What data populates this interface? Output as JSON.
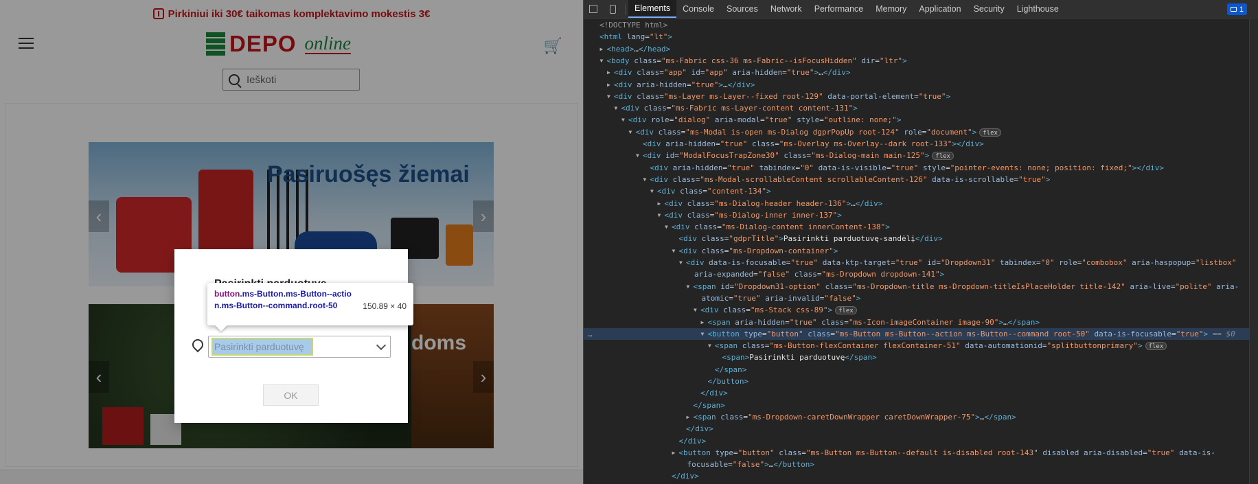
{
  "page": {
    "promo_text": "Pirkiniui iki 30€ taikomas komplektavimo mokestis 3€",
    "logo_text": "DEPO",
    "logo_online": "online",
    "search_placeholder": "Ieškoti",
    "banner1_title": "Pasiruošęs žiemai",
    "banner2_text": "doms",
    "dialog": {
      "title": "Pasirinkti parduotuvę",
      "dropdown_value": "Pasirinkti parduotuvę",
      "ok_label": "OK"
    },
    "tooltip": {
      "tag": "button",
      "selector": ".ms-Button.ms-Button--action.ms-Button--command.root-50",
      "dims": "150.89 × 40"
    }
  },
  "devtools": {
    "tabs": [
      "Elements",
      "Console",
      "Sources",
      "Network",
      "Performance",
      "Memory",
      "Application",
      "Security",
      "Lighthouse"
    ],
    "active_tab": "Elements",
    "issues_count": "1",
    "dom_lines": [
      {
        "indent": 0,
        "arrow": "",
        "html": "<span class='tok-kw'>&lt;!DOCTYPE html&gt;</span>"
      },
      {
        "indent": 0,
        "arrow": "",
        "html": "<span class='tok-tag'>&lt;html</span> <span class='tok-attr'>lang</span>=<span class='tok-val'>\"lt\"</span><span class='tok-tag'>&gt;</span>"
      },
      {
        "indent": 1,
        "arrow": "▶",
        "html": "<span class='tok-tag'>&lt;head&gt;</span>…<span class='tok-tag'>&lt;/head&gt;</span>"
      },
      {
        "indent": 1,
        "arrow": "▼",
        "html": "<span class='tok-tag'>&lt;body</span> <span class='tok-attr'>class</span>=<span class='tok-val'>\"ms-Fabric css-36 ms-Fabric--isFocusHidden\"</span> <span class='tok-attr'>dir</span>=<span class='tok-val'>\"ltr\"</span><span class='tok-tag'>&gt;</span>"
      },
      {
        "indent": 2,
        "arrow": "▶",
        "html": "<span class='tok-tag'>&lt;div</span> <span class='tok-attr'>class</span>=<span class='tok-val'>\"app\"</span> <span class='tok-attr'>id</span>=<span class='tok-val'>\"app\"</span> <span class='tok-attr'>aria-hidden</span>=<span class='tok-val'>\"true\"</span><span class='tok-tag'>&gt;</span>…<span class='tok-tag'>&lt;/div&gt;</span>"
      },
      {
        "indent": 2,
        "arrow": "▶",
        "html": "<span class='tok-tag'>&lt;div</span> <span class='tok-attr'>aria-hidden</span>=<span class='tok-val'>\"true\"</span><span class='tok-tag'>&gt;</span>…<span class='tok-tag'>&lt;/div&gt;</span>"
      },
      {
        "indent": 2,
        "arrow": "▼",
        "html": "<span class='tok-tag'>&lt;div</span> <span class='tok-attr'>class</span>=<span class='tok-val'>\"ms-Layer ms-Layer--fixed root-129\"</span> <span class='tok-attr'>data-portal-element</span>=<span class='tok-val'>\"true\"</span><span class='tok-tag'>&gt;</span>"
      },
      {
        "indent": 3,
        "arrow": "▼",
        "html": "<span class='tok-tag'>&lt;div</span> <span class='tok-attr'>class</span>=<span class='tok-val'>\"ms-Fabric ms-Layer-content content-131\"</span><span class='tok-tag'>&gt;</span>"
      },
      {
        "indent": 4,
        "arrow": "▼",
        "html": "<span class='tok-tag'>&lt;div</span> <span class='tok-attr'>role</span>=<span class='tok-val'>\"dialog\"</span> <span class='tok-attr'>aria-modal</span>=<span class='tok-val'>\"true\"</span> <span class='tok-attr'>style</span>=<span class='tok-val'>\"outline: none;\"</span><span class='tok-tag'>&gt;</span>"
      },
      {
        "indent": 5,
        "arrow": "▼",
        "html": "<span class='tok-tag'>&lt;div</span> <span class='tok-attr'>class</span>=<span class='tok-val'>\"ms-Modal is-open ms-Dialog dgprPopUp root-124\"</span> <span class='tok-attr'>role</span>=<span class='tok-val'>\"document\"</span><span class='tok-tag'>&gt;</span><span class='pill'>flex</span>"
      },
      {
        "indent": 6,
        "arrow": "",
        "html": "<span class='tok-tag'>&lt;div</span> <span class='tok-attr'>aria-hidden</span>=<span class='tok-val'>\"true\"</span> <span class='tok-attr'>class</span>=<span class='tok-val'>\"ms-Overlay ms-Overlay--dark root-133\"</span><span class='tok-tag'>&gt;&lt;/div&gt;</span>"
      },
      {
        "indent": 6,
        "arrow": "▼",
        "html": "<span class='tok-tag'>&lt;div</span> <span class='tok-attr'>id</span>=<span class='tok-val'>\"ModalFocusTrapZone30\"</span> <span class='tok-attr'>class</span>=<span class='tok-val'>\"ms-Dialog-main main-125\"</span><span class='tok-tag'>&gt;</span><span class='pill'>flex</span>"
      },
      {
        "indent": 7,
        "arrow": "",
        "html": "<span class='tok-tag'>&lt;div</span> <span class='tok-attr'>aria-hidden</span>=<span class='tok-val'>\"true\"</span> <span class='tok-attr'>tabindex</span>=<span class='tok-val'>\"0\"</span> <span class='tok-attr'>data-is-visible</span>=<span class='tok-val'>\"true\"</span> <span class='tok-attr'>style</span>=<span class='tok-val'>\"pointer-events: none; position: fixed;\"</span><span class='tok-tag'>&gt;&lt;/div&gt;</span>"
      },
      {
        "indent": 7,
        "arrow": "▼",
        "html": "<span class='tok-tag'>&lt;div</span> <span class='tok-attr'>class</span>=<span class='tok-val'>\"ms-Modal-scrollableContent scrollableContent-126\"</span> <span class='tok-attr'>data-is-scrollable</span>=<span class='tok-val'>\"true\"</span><span class='tok-tag'>&gt;</span>"
      },
      {
        "indent": 8,
        "arrow": "▼",
        "html": "<span class='tok-tag'>&lt;div</span> <span class='tok-attr'>class</span>=<span class='tok-val'>\"content-134\"</span><span class='tok-tag'>&gt;</span>"
      },
      {
        "indent": 9,
        "arrow": "▶",
        "html": "<span class='tok-tag'>&lt;div</span> <span class='tok-attr'>class</span>=<span class='tok-val'>\"ms-Dialog-header header-136\"</span><span class='tok-tag'>&gt;</span>…<span class='tok-tag'>&lt;/div&gt;</span>"
      },
      {
        "indent": 9,
        "arrow": "▼",
        "html": "<span class='tok-tag'>&lt;div</span> <span class='tok-attr'>class</span>=<span class='tok-val'>\"ms-Dialog-inner inner-137\"</span><span class='tok-tag'>&gt;</span>"
      },
      {
        "indent": 10,
        "arrow": "▼",
        "html": "<span class='tok-tag'>&lt;div</span> <span class='tok-attr'>class</span>=<span class='tok-val'>\"ms-Dialog-content innerContent-138\"</span><span class='tok-tag'>&gt;</span>"
      },
      {
        "indent": 11,
        "arrow": "",
        "html": "<span class='tok-tag'>&lt;div</span> <span class='tok-attr'>class</span>=<span class='tok-val'>\"gdprTitle\"</span><span class='tok-tag'>&gt;</span><span class='tok-text'>Pasirinkti parduotuvę-sandėlį</span><span class='tok-tag'>&lt;/div&gt;</span>"
      },
      {
        "indent": 11,
        "arrow": "▼",
        "html": "<span class='tok-tag'>&lt;div</span> <span class='tok-attr'>class</span>=<span class='tok-val'>\"ms-Dropdown-container\"</span><span class='tok-tag'>&gt;</span>"
      },
      {
        "indent": 12,
        "arrow": "▼",
        "html": "<span class='tok-tag'>&lt;div</span> <span class='tok-attr'>data-is-focusable</span>=<span class='tok-val'>\"true\"</span> <span class='tok-attr'>data-ktp-target</span>=<span class='tok-val'>\"true\"</span> <span class='tok-attr'>id</span>=<span class='tok-val'>\"Dropdown31\"</span> <span class='tok-attr'>tabindex</span>=<span class='tok-val'>\"0\"</span> <span class='tok-attr'>role</span>=<span class='tok-val'>\"combobox\"</span> <span class='tok-attr'>aria-haspopup</span>=<span class='tok-val'>\"listbox\"</span>"
      },
      {
        "indent": 12,
        "arrow": "",
        "cont": true,
        "html": "<span class='tok-attr'>aria-expanded</span>=<span class='tok-val'>\"false\"</span> <span class='tok-attr'>class</span>=<span class='tok-val'>\"ms-Dropdown dropdown-141\"</span><span class='tok-tag'>&gt;</span>"
      },
      {
        "indent": 13,
        "arrow": "▼",
        "html": "<span class='tok-tag'>&lt;span</span> <span class='tok-attr'>id</span>=<span class='tok-val'>\"Dropdown31-option\"</span> <span class='tok-attr'>class</span>=<span class='tok-val'>\"ms-Dropdown-title ms-Dropdown-titleIsPlaceHolder title-142\"</span> <span class='tok-attr'>aria-live</span>=<span class='tok-val'>\"polite\"</span> <span class='tok-attr'>aria-</span>"
      },
      {
        "indent": 13,
        "arrow": "",
        "cont": true,
        "html": "<span class='tok-attr'>atomic</span>=<span class='tok-val'>\"true\"</span> <span class='tok-attr'>aria-invalid</span>=<span class='tok-val'>\"false\"</span><span class='tok-tag'>&gt;</span>"
      },
      {
        "indent": 14,
        "arrow": "▼",
        "html": "<span class='tok-tag'>&lt;div</span> <span class='tok-attr'>class</span>=<span class='tok-val'>\"ms-Stack css-89\"</span><span class='tok-tag'>&gt;</span><span class='pill'>flex</span>"
      },
      {
        "indent": 15,
        "arrow": "▶",
        "html": "<span class='tok-tag'>&lt;span</span> <span class='tok-attr'>aria-hidden</span>=<span class='tok-val'>\"true\"</span> <span class='tok-attr'>class</span>=<span class='tok-val'>\"ms-Icon-imageContainer image-90\"</span><span class='tok-tag'>&gt;</span>…<span class='tok-tag'>&lt;/span&gt;</span>"
      },
      {
        "indent": 15,
        "arrow": "▼",
        "sel": true,
        "html": "<span class='tok-tag'>&lt;button</span> <span class='tok-attr'>type</span>=<span class='tok-val'>\"button\"</span> <span class='tok-attr'>class</span>=<span class='tok-val'>\"ms-Button ms-Button--action ms-Button--command root-50\"</span> <span class='tok-attr'>data-is-focusable</span>=<span class='tok-val'>\"true\"</span><span class='tok-tag'>&gt;</span> <span class='eq'>== $0</span>"
      },
      {
        "indent": 16,
        "arrow": "▼",
        "html": "<span class='tok-tag'>&lt;span</span> <span class='tok-attr'>class</span>=<span class='tok-val'>\"ms-Button-flexContainer flexContainer-51\"</span> <span class='tok-attr'>data-automationid</span>=<span class='tok-val'>\"splitbuttonprimary\"</span><span class='tok-tag'>&gt;</span><span class='pill'>flex</span>"
      },
      {
        "indent": 17,
        "arrow": "",
        "html": "<span class='tok-tag'>&lt;span&gt;</span><span class='tok-text'>Pasirinkti parduotuvę</span><span class='tok-tag'>&lt;/span&gt;</span>"
      },
      {
        "indent": 16,
        "arrow": "",
        "html": "<span class='tok-tag'>&lt;/span&gt;</span>"
      },
      {
        "indent": 15,
        "arrow": "",
        "html": "<span class='tok-tag'>&lt;/button&gt;</span>"
      },
      {
        "indent": 14,
        "arrow": "",
        "html": "<span class='tok-tag'>&lt;/div&gt;</span>"
      },
      {
        "indent": 13,
        "arrow": "",
        "html": "<span class='tok-tag'>&lt;/span&gt;</span>"
      },
      {
        "indent": 13,
        "arrow": "▶",
        "html": "<span class='tok-tag'>&lt;span</span> <span class='tok-attr'>class</span>=<span class='tok-val'>\"ms-Dropdown-caretDownWrapper caretDownWrapper-75\"</span><span class='tok-tag'>&gt;</span>…<span class='tok-tag'>&lt;/span&gt;</span>"
      },
      {
        "indent": 12,
        "arrow": "",
        "html": "<span class='tok-tag'>&lt;/div&gt;</span>"
      },
      {
        "indent": 11,
        "arrow": "",
        "html": "<span class='tok-tag'>&lt;/div&gt;</span>"
      },
      {
        "indent": 11,
        "arrow": "▶",
        "html": "<span class='tok-tag'>&lt;button</span> <span class='tok-attr'>type</span>=<span class='tok-val'>\"button\"</span> <span class='tok-attr'>class</span>=<span class='tok-val'>\"ms-Button ms-Button--default is-disabled root-143\"</span> <span class='tok-attr'>disabled</span> <span class='tok-attr'>aria-disabled</span>=<span class='tok-val'>\"true\"</span> <span class='tok-attr'>data-is-</span>"
      },
      {
        "indent": 11,
        "arrow": "",
        "cont": true,
        "html": "<span class='tok-attr'>focusable</span>=<span class='tok-val'>\"false\"</span><span class='tok-tag'>&gt;</span>…<span class='tok-tag'>&lt;/button&gt;</span>"
      },
      {
        "indent": 10,
        "arrow": "",
        "html": "<span class='tok-tag'>&lt;/div&gt;</span>"
      }
    ]
  }
}
